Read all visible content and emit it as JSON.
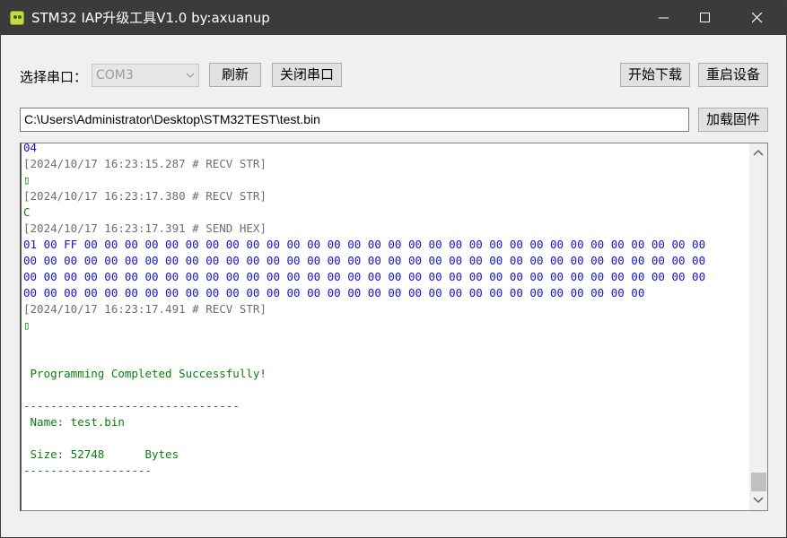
{
  "window": {
    "title": "STM32 IAP升级工具V1.0 by:axuanup"
  },
  "toolbar": {
    "port_label": "选择串口：",
    "port_value": "COM3",
    "refresh_label": "刷新",
    "close_port_label": "关闭串口",
    "start_download_label": "开始下载",
    "restart_label": "重启设备"
  },
  "file": {
    "path": "C:\\Users\\Administrator\\Desktop\\STM32TEST\\test.bin",
    "load_label": "加载固件"
  },
  "log": {
    "lines": [
      {
        "text": "04",
        "color": "blue"
      },
      {
        "text": "[2024/10/17 16:23:15.287 # RECV STR]",
        "color": "gray"
      },
      {
        "text": "▯",
        "color": "green"
      },
      {
        "text": "[2024/10/17 16:23:17.380 # RECV STR]",
        "color": "gray"
      },
      {
        "text": "C",
        "color": "green"
      },
      {
        "text": "[2024/10/17 16:23:17.391 # SEND HEX]",
        "color": "gray"
      },
      {
        "text": "01 00 FF 00 00 00 00 00 00 00 00 00 00 00 00 00 00 00 00 00 00 00 00 00 00 00 00 00 00 00 00 00 00 00",
        "color": "blue"
      },
      {
        "text": "00 00 00 00 00 00 00 00 00 00 00 00 00 00 00 00 00 00 00 00 00 00 00 00 00 00 00 00 00 00 00 00 00 00",
        "color": "blue"
      },
      {
        "text": "00 00 00 00 00 00 00 00 00 00 00 00 00 00 00 00 00 00 00 00 00 00 00 00 00 00 00 00 00 00 00 00 00 00",
        "color": "blue"
      },
      {
        "text": "00 00 00 00 00 00 00 00 00 00 00 00 00 00 00 00 00 00 00 00 00 00 00 00 00 00 00 00 00 00 00",
        "color": "blue"
      },
      {
        "text": "[2024/10/17 16:23:17.491 # RECV STR]",
        "color": "gray"
      },
      {
        "text": "▯",
        "color": "green"
      },
      {
        "text": "",
        "color": "green"
      },
      {
        "text": "",
        "color": "green"
      },
      {
        "text": " Programming Completed Successfully!",
        "color": "green"
      },
      {
        "text": "",
        "color": "green"
      },
      {
        "text": "--------------------------------",
        "color": "green"
      },
      {
        "text": " Name: test.bin",
        "color": "green"
      },
      {
        "text": "",
        "color": "green"
      },
      {
        "text": " Size: 52748      Bytes",
        "color": "green"
      },
      {
        "text": "-------------------",
        "color": "green"
      }
    ]
  },
  "colors": {
    "titlebar": "#3b3b3b",
    "gray_text": "#6f6f6f",
    "green_text": "#0a7f0a",
    "blue_text": "#1414c8"
  },
  "icons": [
    "app-icon",
    "minimize-icon",
    "maximize-icon",
    "close-icon",
    "chevron-down-icon",
    "scroll-up-icon",
    "scroll-down-icon"
  ]
}
